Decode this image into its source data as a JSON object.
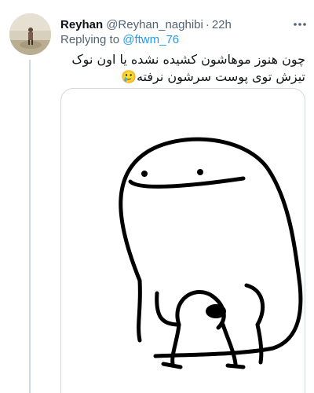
{
  "tweet": {
    "author_name": "Reyhan",
    "author_handle": "@Reyhan_naghibi",
    "separator": "·",
    "timestamp": "22h",
    "replying_to_prefix": "Replying to",
    "replying_to_handle": "@ftwm_76",
    "text": "چون هنوز موهاشون کشیده نشده یا اون نوک تیزش توی پوست سرشون نرفته",
    "text_tail_glyph": "🥲",
    "more_icon": "more-horizontal-icon",
    "media_description_icon": "meme-drawing"
  },
  "colors": {
    "link": "#1d9bf0",
    "secondary_text": "#536471",
    "primary_text": "#0f1419",
    "border": "#cfd9de"
  }
}
